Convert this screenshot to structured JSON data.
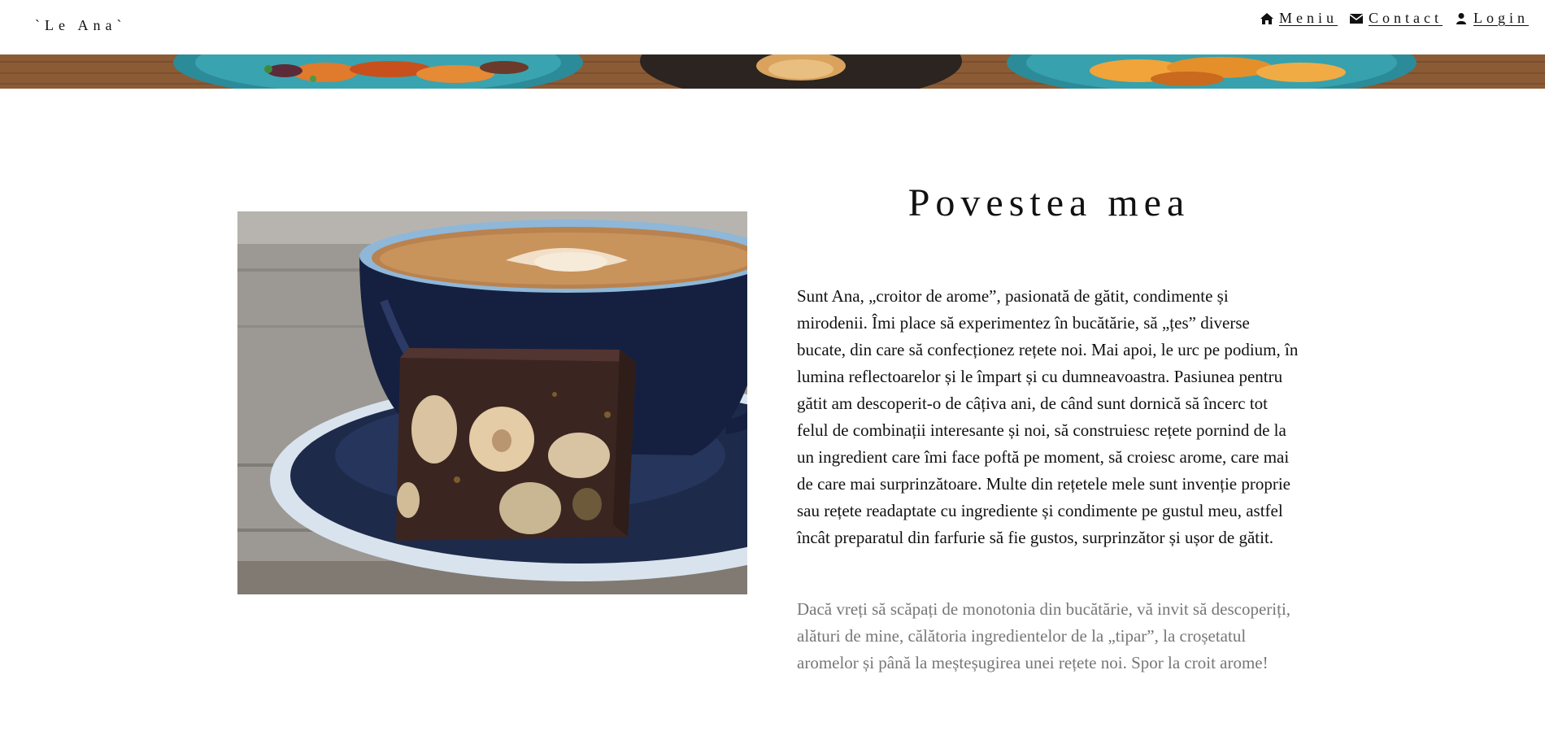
{
  "header": {
    "brand": "`Le Ana`",
    "nav": [
      {
        "icon": "home-icon",
        "label": "Meniu"
      },
      {
        "icon": "envelope-icon",
        "label": "Contact"
      },
      {
        "icon": "user-icon",
        "label": "Login"
      }
    ]
  },
  "main": {
    "title": "Povestea mea",
    "paragraph_1": "Sunt Ana, „croitor de arome”, pasionată de gătit, condimente și mirodenii. Îmi place să experimentez în bucătărie, să „țes” diverse bucate, din care să confecționez rețete noi. Mai apoi, le urc pe podium, în lumina reflectoarelor și le împart și cu dumneavoastra. Pasiunea pentru gătit am descoperit-o de câțiva ani, de când sunt dornică să încerc tot felul de combinații interesante și noi, să construiesc rețete pornind de la un ingredient care îmi face poftă pe moment, să croiesc arome, care mai de care mai surprinzătoare. Multe din rețetele mele sunt invenție proprie sau rețete readaptate cu ingrediente și condimente pe gustul meu, astfel încât preparatul din farfurie să fie gustos, surprinzător și ușor de gătit.",
    "paragraph_2": "Dacă vreți să scăpați de monotonia din bucătărie, vă invit să descoperiți, alături de mine, călătoria ingredientelor de la „tipar”, la croșetatul aromelor și până la meșteșugirea unei rețete noi. Spor la croit arome!"
  },
  "colors": {
    "text": "#111111",
    "muted_text": "#777777",
    "background": "#ffffff"
  }
}
